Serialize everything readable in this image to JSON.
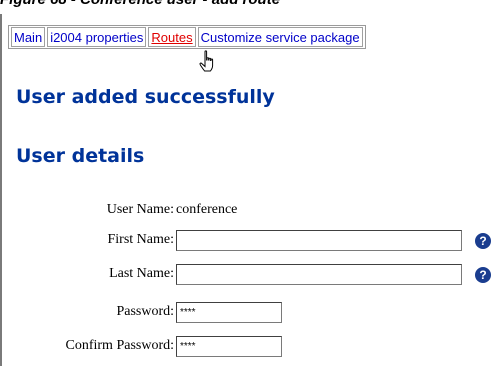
{
  "caption": "Figure 68 - Conference user - add route",
  "tabs": [
    {
      "label": "Main"
    },
    {
      "label": "i2004 properties"
    },
    {
      "label": "Routes"
    },
    {
      "label": "Customize service package"
    }
  ],
  "headings": {
    "added": "User added successfully",
    "details": "User details"
  },
  "form": {
    "username_label": "User Name:",
    "username_value": "conference",
    "firstname_label": "First Name:",
    "firstname_value": "",
    "lastname_label": "Last Name:",
    "lastname_value": "",
    "password_label": "Password:",
    "password_value": "****",
    "confirm_label": "Confirm Password:",
    "confirm_value": "****",
    "help_glyph": "?"
  },
  "colors": {
    "heading": "#003399",
    "link": "#0000c8",
    "active_link": "#e00000",
    "help_icon": "#1a3d8f"
  },
  "icons": {
    "cursor": "hand-pointer-icon",
    "help": "help-icon"
  }
}
